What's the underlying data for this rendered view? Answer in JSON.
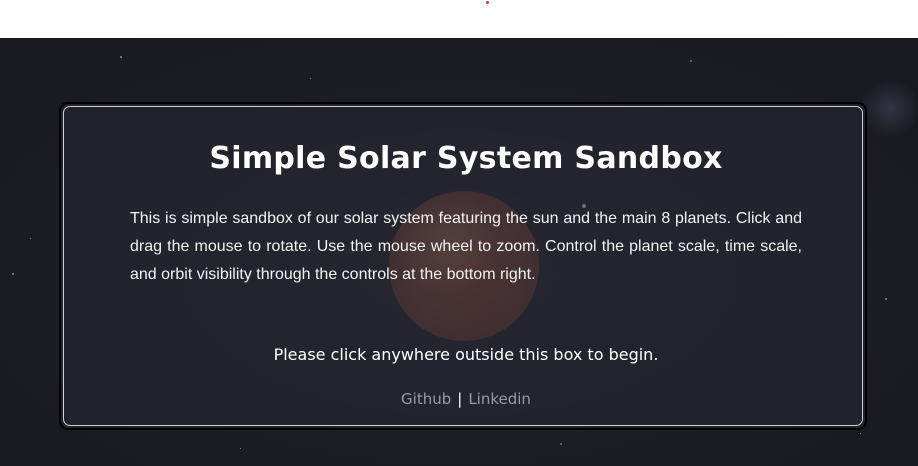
{
  "modal": {
    "title": "Simple Solar System Sandbox",
    "description": "This is simple sandbox of our solar system featuring the sun and the main 8 planets. Click and drag the mouse to rotate. Use the mouse wheel to zoom. Control the planet scale, time scale, and orbit visibility through the controls at the bottom right.",
    "prompt": "Please click anywhere outside this box to begin.",
    "links": {
      "github": "Github",
      "separator": "|",
      "linkedin": "Linkedin"
    }
  },
  "colors": {
    "background": "#1e1e26",
    "text": "#ffffff",
    "link": "#9a9aa2",
    "sun": "#7e4732"
  }
}
